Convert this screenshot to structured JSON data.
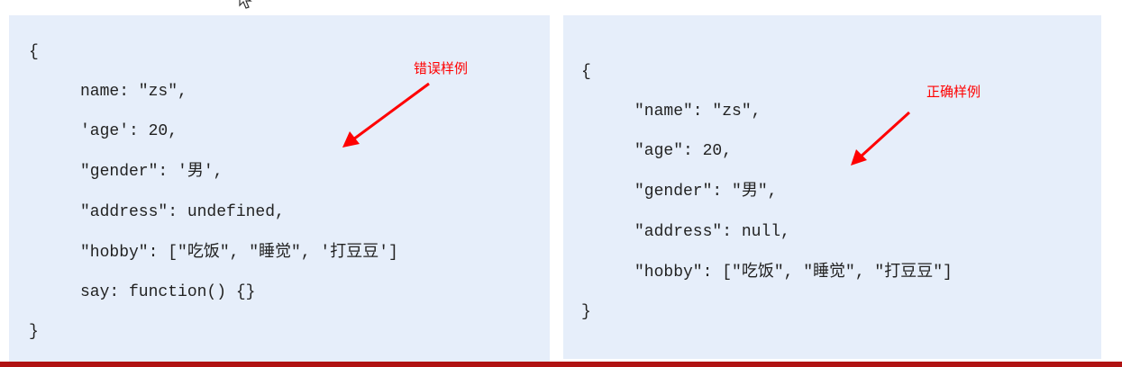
{
  "wrong_example": {
    "label": "错误样例",
    "lines": [
      "{",
      "name: \"zs\",",
      "'age': 20,",
      "\"gender\": '男',",
      "\"address\": undefined,",
      "\"hobby\": [\"吃饭\", \"睡觉\", '打豆豆']",
      "say: function() {}",
      "}"
    ]
  },
  "correct_example": {
    "label": "正确样例",
    "lines": [
      "{",
      "\"name\": \"zs\",",
      "\"age\": 20,",
      "\"gender\": \"男\",",
      "\"address\": null,",
      "\"hobby\": [\"吃饭\", \"睡觉\", \"打豆豆\"]",
      "}"
    ]
  },
  "colors": {
    "panel": "#e6eefa",
    "annotation": "#ff0000",
    "bottom_bar": "#b01212"
  }
}
